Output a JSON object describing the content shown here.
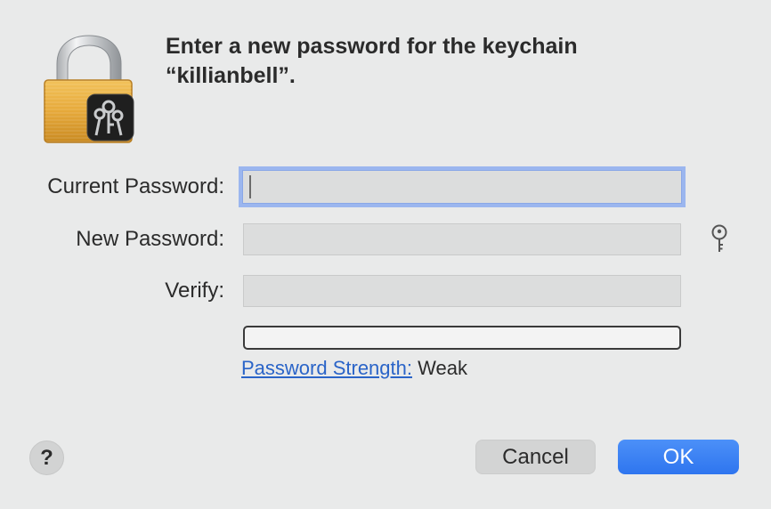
{
  "dialog": {
    "title_line1": "Enter a new password for the keychain",
    "title_line2": "“killianbell”."
  },
  "form": {
    "current_password_label": "Current Password:",
    "current_password_value": "",
    "new_password_label": "New Password:",
    "new_password_value": "",
    "verify_label": "Verify:",
    "verify_value": ""
  },
  "strength": {
    "link_label": "Password Strength:",
    "value": "Weak",
    "level": 0
  },
  "buttons": {
    "help_label": "?",
    "cancel_label": "Cancel",
    "ok_label": "OK"
  },
  "colors": {
    "accent": "#2e75ef",
    "link": "#2a64c8",
    "focus_ring": "#9bb6ef",
    "background": "#e9eaea"
  },
  "icons": {
    "app": "keychain-lock-icon",
    "password_assistant": "key-icon"
  }
}
